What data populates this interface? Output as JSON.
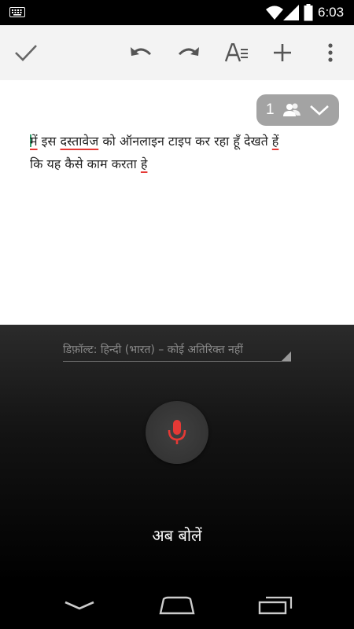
{
  "status_bar": {
    "time": "6:03"
  },
  "toolbar": {
    "icons": [
      "check-icon",
      "undo-icon",
      "redo-icon",
      "text-format-icon",
      "add-icon",
      "overflow-menu-icon"
    ]
  },
  "collaborators": {
    "count": "1"
  },
  "document": {
    "line1_words": [
      "में",
      "इस",
      "दस्तावेज",
      "को",
      "ऑनलाइन",
      "टाइप",
      "कर",
      "रहा",
      "हूँ",
      "देखते",
      "हें"
    ],
    "line1_underlined": [
      true,
      false,
      true,
      false,
      false,
      false,
      false,
      false,
      false,
      false,
      true
    ],
    "line2_words": [
      "कि",
      "यह",
      "कैसे",
      "काम",
      "करता",
      "हे"
    ],
    "line2_underlined": [
      false,
      false,
      false,
      false,
      false,
      true
    ]
  },
  "voice": {
    "language": "डिफ़ॉल्ट: हिन्दी (भारत) – कोई अतिरिक्त नहीं",
    "prompt": "अब बोलें",
    "accent_color": "#e53935"
  }
}
